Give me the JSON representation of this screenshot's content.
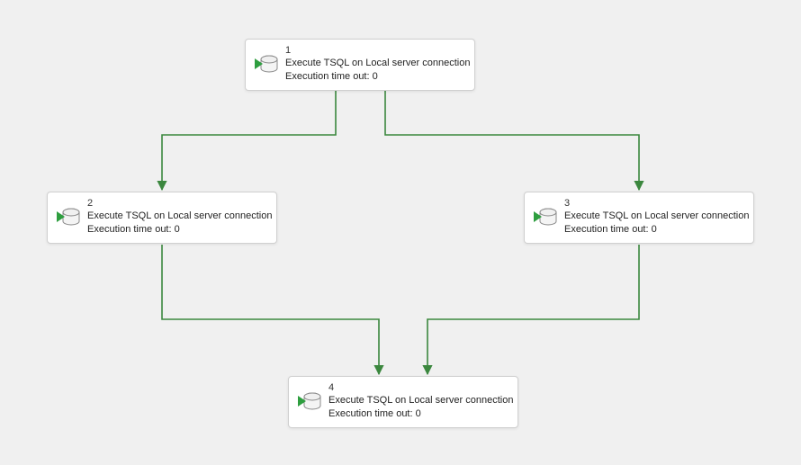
{
  "nodes": {
    "n1": {
      "num": "1",
      "title": "Execute TSQL on Local server connection",
      "sub": "Execution time out: 0"
    },
    "n2": {
      "num": "2",
      "title": "Execute TSQL on Local server connection",
      "sub": "Execution time out: 0"
    },
    "n3": {
      "num": "3",
      "title": "Execute TSQL on Local server connection",
      "sub": "Execution time out: 0"
    },
    "n4": {
      "num": "4",
      "title": "Execute TSQL on Local server connection",
      "sub": "Execution time out: 0"
    }
  },
  "colors": {
    "connector": "#3b873e",
    "node_bg": "#ffffff",
    "canvas_bg": "#f0f0f0"
  },
  "connections": [
    {
      "from": "n1",
      "to": "n2"
    },
    {
      "from": "n1",
      "to": "n3"
    },
    {
      "from": "n2",
      "to": "n4"
    },
    {
      "from": "n3",
      "to": "n4"
    }
  ]
}
